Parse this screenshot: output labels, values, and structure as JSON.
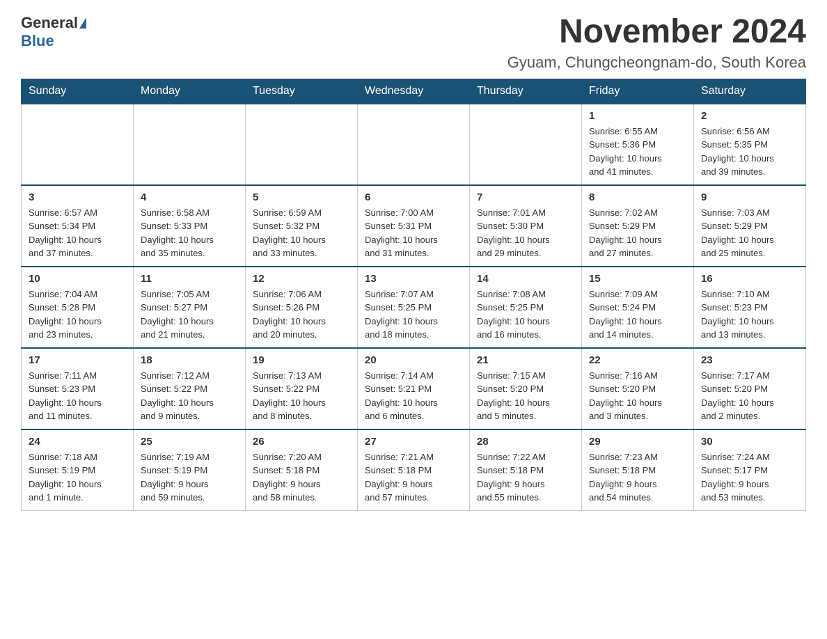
{
  "header": {
    "logo_general": "General",
    "logo_blue": "Blue",
    "month_title": "November 2024",
    "location": "Gyuam, Chungcheongnam-do, South Korea"
  },
  "days_of_week": [
    "Sunday",
    "Monday",
    "Tuesday",
    "Wednesday",
    "Thursday",
    "Friday",
    "Saturday"
  ],
  "weeks": [
    [
      {
        "day": "",
        "info": ""
      },
      {
        "day": "",
        "info": ""
      },
      {
        "day": "",
        "info": ""
      },
      {
        "day": "",
        "info": ""
      },
      {
        "day": "",
        "info": ""
      },
      {
        "day": "1",
        "info": "Sunrise: 6:55 AM\nSunset: 5:36 PM\nDaylight: 10 hours\nand 41 minutes."
      },
      {
        "day": "2",
        "info": "Sunrise: 6:56 AM\nSunset: 5:35 PM\nDaylight: 10 hours\nand 39 minutes."
      }
    ],
    [
      {
        "day": "3",
        "info": "Sunrise: 6:57 AM\nSunset: 5:34 PM\nDaylight: 10 hours\nand 37 minutes."
      },
      {
        "day": "4",
        "info": "Sunrise: 6:58 AM\nSunset: 5:33 PM\nDaylight: 10 hours\nand 35 minutes."
      },
      {
        "day": "5",
        "info": "Sunrise: 6:59 AM\nSunset: 5:32 PM\nDaylight: 10 hours\nand 33 minutes."
      },
      {
        "day": "6",
        "info": "Sunrise: 7:00 AM\nSunset: 5:31 PM\nDaylight: 10 hours\nand 31 minutes."
      },
      {
        "day": "7",
        "info": "Sunrise: 7:01 AM\nSunset: 5:30 PM\nDaylight: 10 hours\nand 29 minutes."
      },
      {
        "day": "8",
        "info": "Sunrise: 7:02 AM\nSunset: 5:29 PM\nDaylight: 10 hours\nand 27 minutes."
      },
      {
        "day": "9",
        "info": "Sunrise: 7:03 AM\nSunset: 5:29 PM\nDaylight: 10 hours\nand 25 minutes."
      }
    ],
    [
      {
        "day": "10",
        "info": "Sunrise: 7:04 AM\nSunset: 5:28 PM\nDaylight: 10 hours\nand 23 minutes."
      },
      {
        "day": "11",
        "info": "Sunrise: 7:05 AM\nSunset: 5:27 PM\nDaylight: 10 hours\nand 21 minutes."
      },
      {
        "day": "12",
        "info": "Sunrise: 7:06 AM\nSunset: 5:26 PM\nDaylight: 10 hours\nand 20 minutes."
      },
      {
        "day": "13",
        "info": "Sunrise: 7:07 AM\nSunset: 5:25 PM\nDaylight: 10 hours\nand 18 minutes."
      },
      {
        "day": "14",
        "info": "Sunrise: 7:08 AM\nSunset: 5:25 PM\nDaylight: 10 hours\nand 16 minutes."
      },
      {
        "day": "15",
        "info": "Sunrise: 7:09 AM\nSunset: 5:24 PM\nDaylight: 10 hours\nand 14 minutes."
      },
      {
        "day": "16",
        "info": "Sunrise: 7:10 AM\nSunset: 5:23 PM\nDaylight: 10 hours\nand 13 minutes."
      }
    ],
    [
      {
        "day": "17",
        "info": "Sunrise: 7:11 AM\nSunset: 5:23 PM\nDaylight: 10 hours\nand 11 minutes."
      },
      {
        "day": "18",
        "info": "Sunrise: 7:12 AM\nSunset: 5:22 PM\nDaylight: 10 hours\nand 9 minutes."
      },
      {
        "day": "19",
        "info": "Sunrise: 7:13 AM\nSunset: 5:22 PM\nDaylight: 10 hours\nand 8 minutes."
      },
      {
        "day": "20",
        "info": "Sunrise: 7:14 AM\nSunset: 5:21 PM\nDaylight: 10 hours\nand 6 minutes."
      },
      {
        "day": "21",
        "info": "Sunrise: 7:15 AM\nSunset: 5:20 PM\nDaylight: 10 hours\nand 5 minutes."
      },
      {
        "day": "22",
        "info": "Sunrise: 7:16 AM\nSunset: 5:20 PM\nDaylight: 10 hours\nand 3 minutes."
      },
      {
        "day": "23",
        "info": "Sunrise: 7:17 AM\nSunset: 5:20 PM\nDaylight: 10 hours\nand 2 minutes."
      }
    ],
    [
      {
        "day": "24",
        "info": "Sunrise: 7:18 AM\nSunset: 5:19 PM\nDaylight: 10 hours\nand 1 minute."
      },
      {
        "day": "25",
        "info": "Sunrise: 7:19 AM\nSunset: 5:19 PM\nDaylight: 9 hours\nand 59 minutes."
      },
      {
        "day": "26",
        "info": "Sunrise: 7:20 AM\nSunset: 5:18 PM\nDaylight: 9 hours\nand 58 minutes."
      },
      {
        "day": "27",
        "info": "Sunrise: 7:21 AM\nSunset: 5:18 PM\nDaylight: 9 hours\nand 57 minutes."
      },
      {
        "day": "28",
        "info": "Sunrise: 7:22 AM\nSunset: 5:18 PM\nDaylight: 9 hours\nand 55 minutes."
      },
      {
        "day": "29",
        "info": "Sunrise: 7:23 AM\nSunset: 5:18 PM\nDaylight: 9 hours\nand 54 minutes."
      },
      {
        "day": "30",
        "info": "Sunrise: 7:24 AM\nSunset: 5:17 PM\nDaylight: 9 hours\nand 53 minutes."
      }
    ]
  ]
}
